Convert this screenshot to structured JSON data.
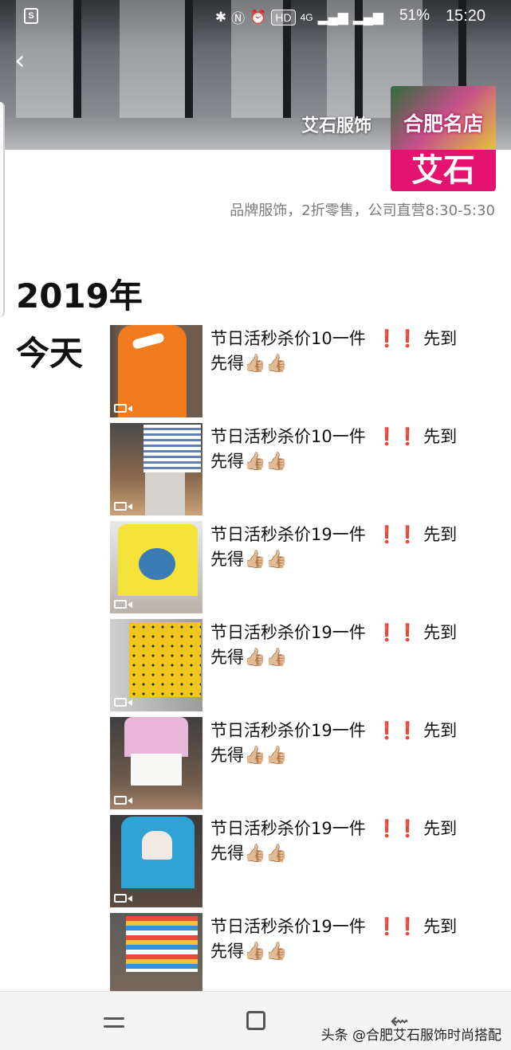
{
  "status_bar": {
    "left_icon": "S",
    "network": "4G",
    "hd": "HD",
    "battery": "51%",
    "time": "15:20"
  },
  "header": {
    "back_icon": "‹",
    "name": "艾石服饰",
    "avatar_top": "合肥名店",
    "avatar_bottom": "艾石",
    "signature": "品牌服饰，2折零售，公司直营8:30-5:30"
  },
  "timeline": {
    "year": "2019年",
    "day": "今天"
  },
  "posts": [
    {
      "text": "节日活秒杀价10一件",
      "excl": "❗❗",
      "tail": "先到先得",
      "thumbs": "👍🏼👍🏼"
    },
    {
      "text": "节日活秒杀价10一件",
      "excl": "❗❗",
      "tail": "先到先得",
      "thumbs": "👍🏼👍🏼"
    },
    {
      "text": "节日活秒杀价19一件",
      "excl": "❗❗",
      "tail": "先到先得",
      "thumbs": "👍🏼👍🏼"
    },
    {
      "text": "节日活秒杀价19一件",
      "excl": "❗❗",
      "tail": "先到先得",
      "thumbs": "👍🏼👍🏼"
    },
    {
      "text": "节日活秒杀价19一件",
      "excl": "❗❗",
      "tail": "先到先得",
      "thumbs": "👍🏼👍🏼"
    },
    {
      "text": "节日活秒杀价19一件",
      "excl": "❗❗",
      "tail": "先到先得",
      "thumbs": "👍🏼👍🏼"
    },
    {
      "text": "节日活秒杀价19一件",
      "excl": "❗❗",
      "tail": "先到先得",
      "thumbs": "👍🏼👍🏼"
    }
  ],
  "nav": {
    "back_icon": "⇜"
  },
  "watermark": "头条 @合肥艾石服饰时尚搭配",
  "colors": {
    "accent_pink": "#e4136e",
    "exclamation_red": "#e0142b",
    "signature_gray": "#7b7b7b"
  }
}
